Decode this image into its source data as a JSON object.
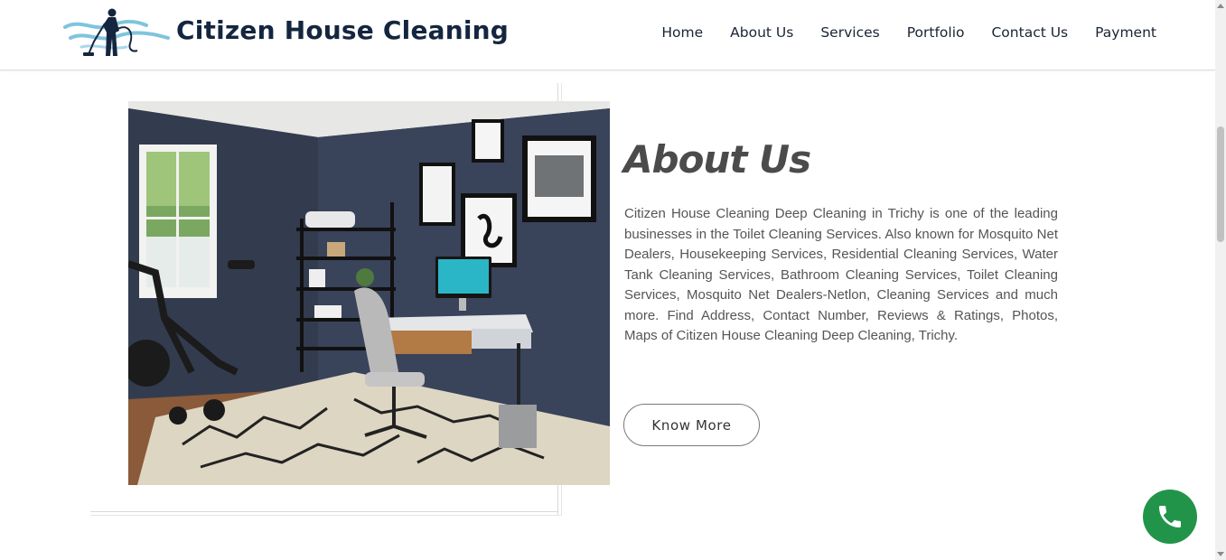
{
  "header": {
    "brand": "Citizen House Cleaning",
    "logo_icon": "cleaner-with-vacuum-icon",
    "nav": [
      {
        "label": "Home"
      },
      {
        "label": "About Us"
      },
      {
        "label": "Services"
      },
      {
        "label": "Portfolio"
      },
      {
        "label": "Contact Us"
      },
      {
        "label": "Payment"
      }
    ]
  },
  "about": {
    "title": "About Us",
    "body": "Citizen House Cleaning Deep Cleaning in Trichy is one of the leading businesses in the Toilet Cleaning Services. Also known for Mosquito Net Dealers, Housekeeping Services, Residential Cleaning Services, Water Tank Cleaning Services, Bathroom Cleaning Services, Toilet Cleaning Services, Mosquito Net Dealers-Netlon, Cleaning Services and much more. Find Address, Contact Number, Reviews & Ratings, Photos, Maps of Citizen House Cleaning Deep Cleaning, Trichy.",
    "button": "Know More",
    "image": "home-office-room-photo"
  },
  "floating": {
    "icon": "phone-icon",
    "color": "#21944a"
  },
  "colors": {
    "brand_text": "#14263f",
    "logo_wave": "#7fc4de",
    "body_text": "#555555"
  }
}
